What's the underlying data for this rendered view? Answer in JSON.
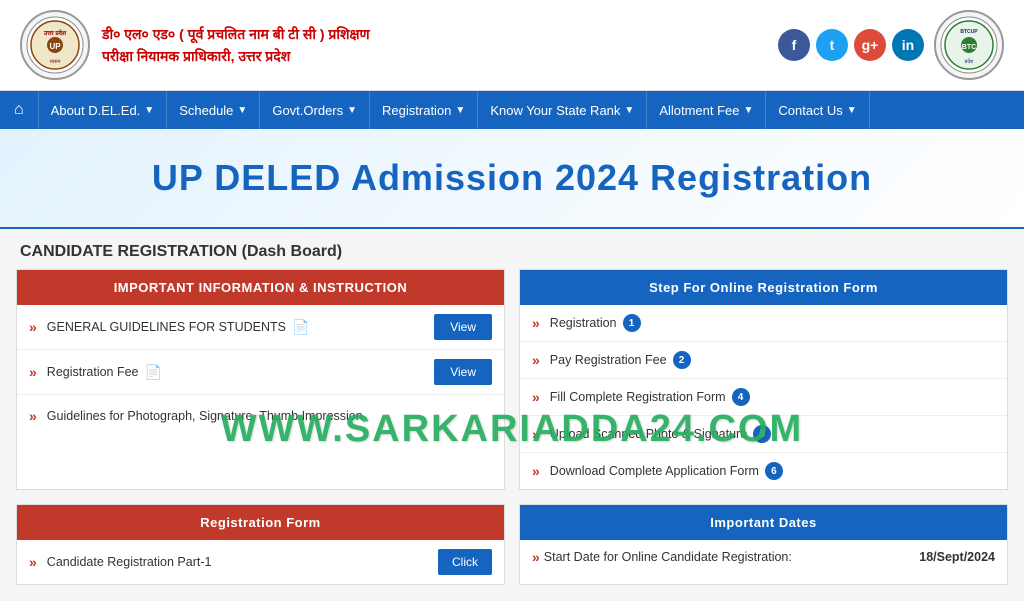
{
  "header": {
    "title_line1": "डी० एल० एड० ( पूर्व प्रचलित नाम बी टी सी ) प्रशिक्षण",
    "title_line2": "परीक्षा नियामक प्राधिकारी, उत्तर प्रदेश",
    "social": {
      "facebook": "f",
      "twitter": "t",
      "googleplus": "g+",
      "linkedin": "in"
    }
  },
  "navbar": {
    "home_icon": "⌂",
    "items": [
      {
        "label": "About D.EL.Ed.",
        "has_dropdown": true
      },
      {
        "label": "Schedule",
        "has_dropdown": true
      },
      {
        "label": "Govt.Orders",
        "has_dropdown": true
      },
      {
        "label": "Registration",
        "has_dropdown": true
      },
      {
        "label": "Know Your State Rank",
        "has_dropdown": true
      },
      {
        "label": "Allotment Fee",
        "has_dropdown": true
      },
      {
        "label": "Contact Us",
        "has_dropdown": true
      }
    ]
  },
  "hero": {
    "title": "UP DELED Admission 2024 Registration"
  },
  "section": {
    "title": "CANDIDATE REGISTRATION (Dash Board)"
  },
  "important_panel": {
    "header": "IMPORTANT INFORMATION & INSTRUCTION",
    "rows": [
      {
        "text": "GENERAL GUIDELINES FOR STUDENTS",
        "has_doc": true,
        "btn": "View"
      },
      {
        "text": "Registration Fee",
        "has_doc": true,
        "btn": "View"
      },
      {
        "text": "Guidelines for Photograph, Signature, Thumb Impression",
        "has_doc": false,
        "btn": null
      }
    ]
  },
  "steps_panel": {
    "header": "Step For Online Registration Form",
    "steps": [
      {
        "text": "Registration",
        "num": "1"
      },
      {
        "text": "Pay Registration Fee",
        "num": "2"
      },
      {
        "text": "Fill Complete Registration Form",
        "num": "4"
      },
      {
        "text": "Upload Scanned Photo & Signature",
        "num": "5"
      },
      {
        "text": "Download Complete Application Form",
        "num": "6"
      }
    ]
  },
  "registration_panel": {
    "header": "Registration Form",
    "rows": [
      {
        "text": "Candidate Registration Part-1",
        "btn": "Click"
      }
    ]
  },
  "dates_panel": {
    "header": "Important Dates",
    "rows": [
      {
        "text": "Start Date for Online Candidate Registration:",
        "value": "18/Sept/2024"
      }
    ]
  },
  "watermark": {
    "text": "WWW.SARKARIADDA24.COM"
  }
}
